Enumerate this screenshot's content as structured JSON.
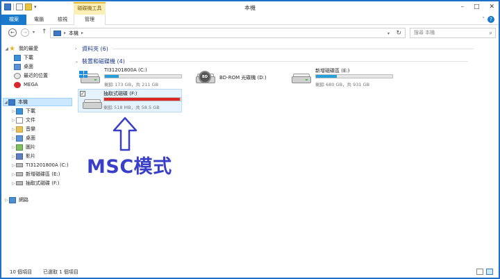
{
  "window": {
    "title": "本機",
    "context_tab": "磁碟機工具",
    "minimize": "–",
    "maximize": "□",
    "close": "✕"
  },
  "ribbon": {
    "tabs": [
      "檔案",
      "電腦",
      "檢視",
      "管理"
    ],
    "help": "?"
  },
  "address": {
    "back": "←",
    "forward": "→",
    "up": "↑",
    "path": "本機",
    "search_placeholder": "搜尋 本機",
    "refresh": "↻"
  },
  "nav": {
    "favorites": {
      "label": "我的最愛",
      "items": [
        "下載",
        "桌面",
        "最近的位置",
        "MEGA"
      ]
    },
    "this_pc": {
      "label": "本機",
      "items": [
        "下載",
        "文件",
        "音樂",
        "桌面",
        "圖片",
        "影片",
        "TI31201800A (C:)",
        "新增磁碟區 (E:)",
        "抽取式磁碟 (F:)"
      ]
    },
    "network": "網路"
  },
  "content": {
    "folders_group": "資料夾 (6)",
    "devices_group": "裝置和磁碟機 (4)",
    "drives": [
      {
        "name": "TI31201800A (C:)",
        "free": "剩餘 173 GB，共 211 GB",
        "used_fraction": 0.18
      },
      {
        "name": "BD-ROM 光碟機 (D:)",
        "free": "",
        "used_fraction": null,
        "disc_label": "BD"
      },
      {
        "name": "新增磁碟區 (E:)",
        "free": "剩餘 680 GB，共 931 GB",
        "used_fraction": 0.27
      },
      {
        "name": "抽取式磁碟 (F:)",
        "free": "剩餘 518 MB，共 58.5 GB",
        "used_fraction": 0.99
      }
    ]
  },
  "annotation": {
    "text": "MSC模式"
  },
  "status": {
    "count": "10 個項目",
    "selected": "已選取 1 個項目"
  }
}
